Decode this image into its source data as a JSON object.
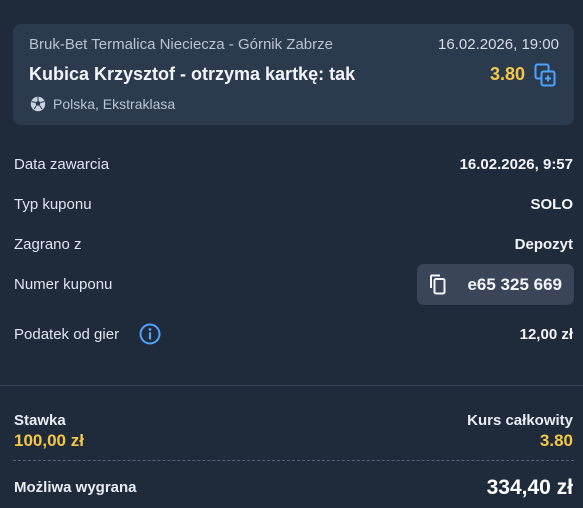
{
  "bet_card": {
    "match": "Bruk-Bet Termalica Nieciecza - Górnik Zabrze",
    "date": "16.02.2026, 19:00",
    "selection": "Kubica Krzysztof - otrzyma kartkę: tak",
    "odds": "3.80",
    "league": "Polska, Ekstraklasa",
    "league_icon": "soccer-ball-icon",
    "copy_icon": "copy-bet-icon"
  },
  "details": {
    "placed_label": "Data zawarcia",
    "placed_value": "16.02.2026, 9:57",
    "type_label": "Typ kuponu",
    "type_value": "SOLO",
    "source_label": "Zagrano z",
    "source_value": "Depozyt",
    "number_label": "Numer kuponu",
    "number_value": "e65 325 669",
    "tax_label": "Podatek od gier",
    "tax_value": "12,00 zł"
  },
  "summary": {
    "stake_label": "Stawka",
    "stake_value": "100,00 zł",
    "total_odds_label": "Kurs całkowity",
    "total_odds_value": "3.80",
    "win_label": "Możliwa wygrana",
    "win_value": "334,40 zł"
  },
  "colors": {
    "background": "#1f2a3b",
    "card": "#2c3a4e",
    "accent_yellow": "#f5c748",
    "accent_blue": "#4da3ff"
  }
}
